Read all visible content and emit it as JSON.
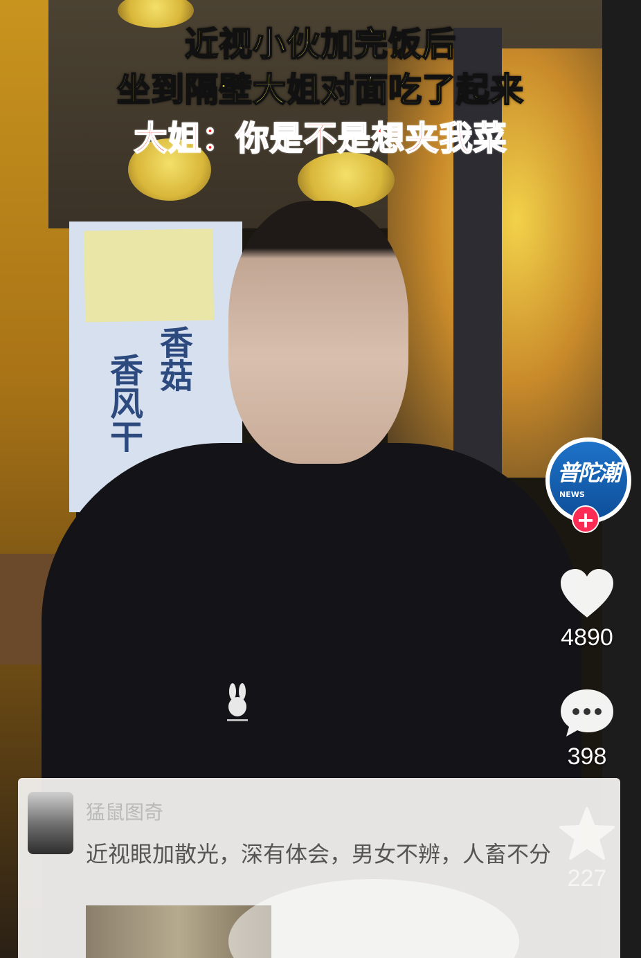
{
  "caption": {
    "line1": "近视小伙加完饭后",
    "line2": "坐到隔壁大姐对面吃了起来",
    "line3": "大姐：你是不是想夹我菜"
  },
  "background_sign": {
    "col1": "香菇",
    "col2": "香风干"
  },
  "account": {
    "avatar_text": "普陀潮",
    "avatar_sub": "NEWS",
    "follow_symbol": "+"
  },
  "actions": {
    "likes": "4890",
    "comments": "398",
    "favorites": "227"
  },
  "comment": {
    "username": "猛鼠图奇",
    "text": "近视眼加散光，深有体会，男女不辨，人畜不分"
  },
  "colors": {
    "caption_yellow": "#fff15a",
    "caption_red": "#e8231b",
    "follow_pink": "#fe2c55",
    "avatar_blue": "#1e72c8"
  },
  "icons": [
    "heart-icon",
    "comment-bubble-icon",
    "star-icon",
    "plus-icon"
  ]
}
